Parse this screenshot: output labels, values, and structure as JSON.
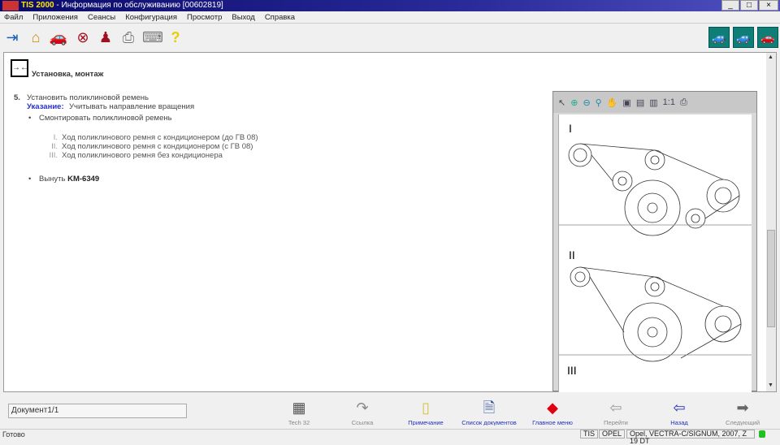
{
  "window": {
    "app": "TIS 2000",
    "title": " - Информация по обслуживанию [00602819]",
    "minimize": "_",
    "maximize": "□",
    "close": "×"
  },
  "menu": [
    "Файл",
    "Приложения",
    "Сеансы",
    "Конфигурация",
    "Просмотр",
    "Выход",
    "Справка"
  ],
  "toolbar": {
    "icons": [
      "exit-icon",
      "home-icon",
      "vehicle-icon",
      "cancel-icon",
      "person-icon",
      "print-icon",
      "keyboard-icon",
      "help-icon"
    ],
    "right_icons": [
      "vehicle-data-icon",
      "vehicle-select-icon",
      "vehicle-info-icon"
    ]
  },
  "content": {
    "heading": "Установка, монтаж",
    "step_number": "5.",
    "step_text": "Установить поликлиновой ремень",
    "note_label": "Указание:",
    "note_text": "Учитывать направление вращения",
    "bullet1": "Смонтировать поликлиновой ремень",
    "sublist": [
      {
        "num": "I.",
        "text": "Ход поликлинового ремня с кондиционером (до ГВ 08)"
      },
      {
        "num": "II.",
        "text": "Ход поликлинового ремня с кондиционером (с ГВ 08)"
      },
      {
        "num": "III.",
        "text": "Ход поликлинового ремня без кондиционера"
      }
    ],
    "bullet2_prefix": "Вынуть ",
    "bullet2_bold": "KM-6349"
  },
  "viewer": {
    "zoom_label": "1:1",
    "figures": [
      "I",
      "II",
      "III"
    ]
  },
  "bottom": {
    "document": "Документ1/1",
    "buttons": [
      {
        "label": "Tech 32",
        "icon": "tech32-icon",
        "icon_char": "▦",
        "color": "#555",
        "active": false
      },
      {
        "label": "Ссылка",
        "icon": "link-arrow-icon",
        "icon_char": "↷",
        "color": "#888",
        "active": false
      },
      {
        "label": "Примечание",
        "icon": "note-icon",
        "icon_char": "▯",
        "color": "#d8c040",
        "active": true
      },
      {
        "label": "Список документов",
        "icon": "document-list-icon",
        "icon_char": "🗎",
        "color": "#3050a0",
        "active": true
      },
      {
        "label": "Главное меню",
        "icon": "main-menu-icon",
        "icon_char": "◆",
        "color": "#e00010",
        "active": true
      },
      {
        "label": "Перейти",
        "icon": "goto-icon",
        "icon_char": "⇦",
        "color": "#999",
        "active": false
      },
      {
        "label": "Назад",
        "icon": "back-arrow-icon",
        "icon_char": "⇦",
        "color": "#2030b0",
        "active": true
      },
      {
        "label": "Следующий",
        "icon": "next-arrow-icon",
        "icon_char": "➡",
        "color": "#666",
        "active": false
      }
    ]
  },
  "status": {
    "text": "Готово",
    "tis": "TIS",
    "make": "OPEL",
    "vehicle": "Opel, VECTRA-C/SIGNUM, 2007, Z 19 DT",
    "indicator_color": "#20c020"
  }
}
